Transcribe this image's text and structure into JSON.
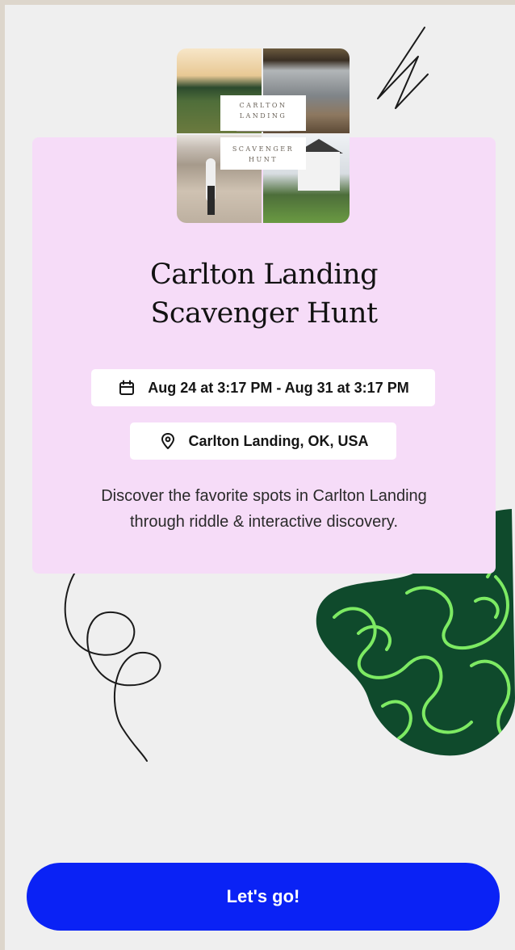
{
  "event": {
    "cover_image_text_line1": "CARLTON",
    "cover_image_text_line2": "LANDING",
    "cover_image_text_line3": "SCAVENGER",
    "cover_image_text_line4": "HUNT",
    "title_line1": "Carlton Landing",
    "title_line2": "Scavenger Hunt",
    "date_range": "Aug 24 at 3:17 PM - Aug 31 at 3:17 PM",
    "date_icon": "calendar-icon",
    "location": "Carlton Landing, OK, USA",
    "location_icon": "location-pin-icon",
    "description_line1": "Discover the favorite spots in Carlton Landing",
    "description_line2": "through riddle & interactive discovery."
  },
  "actions": {
    "primary_label": "Let's go!"
  },
  "colors": {
    "card_background": "#f6dcf8",
    "button_background": "#0a22f5",
    "blob_dark_green": "#0f4a2c",
    "blob_light_green": "#7dea63"
  }
}
